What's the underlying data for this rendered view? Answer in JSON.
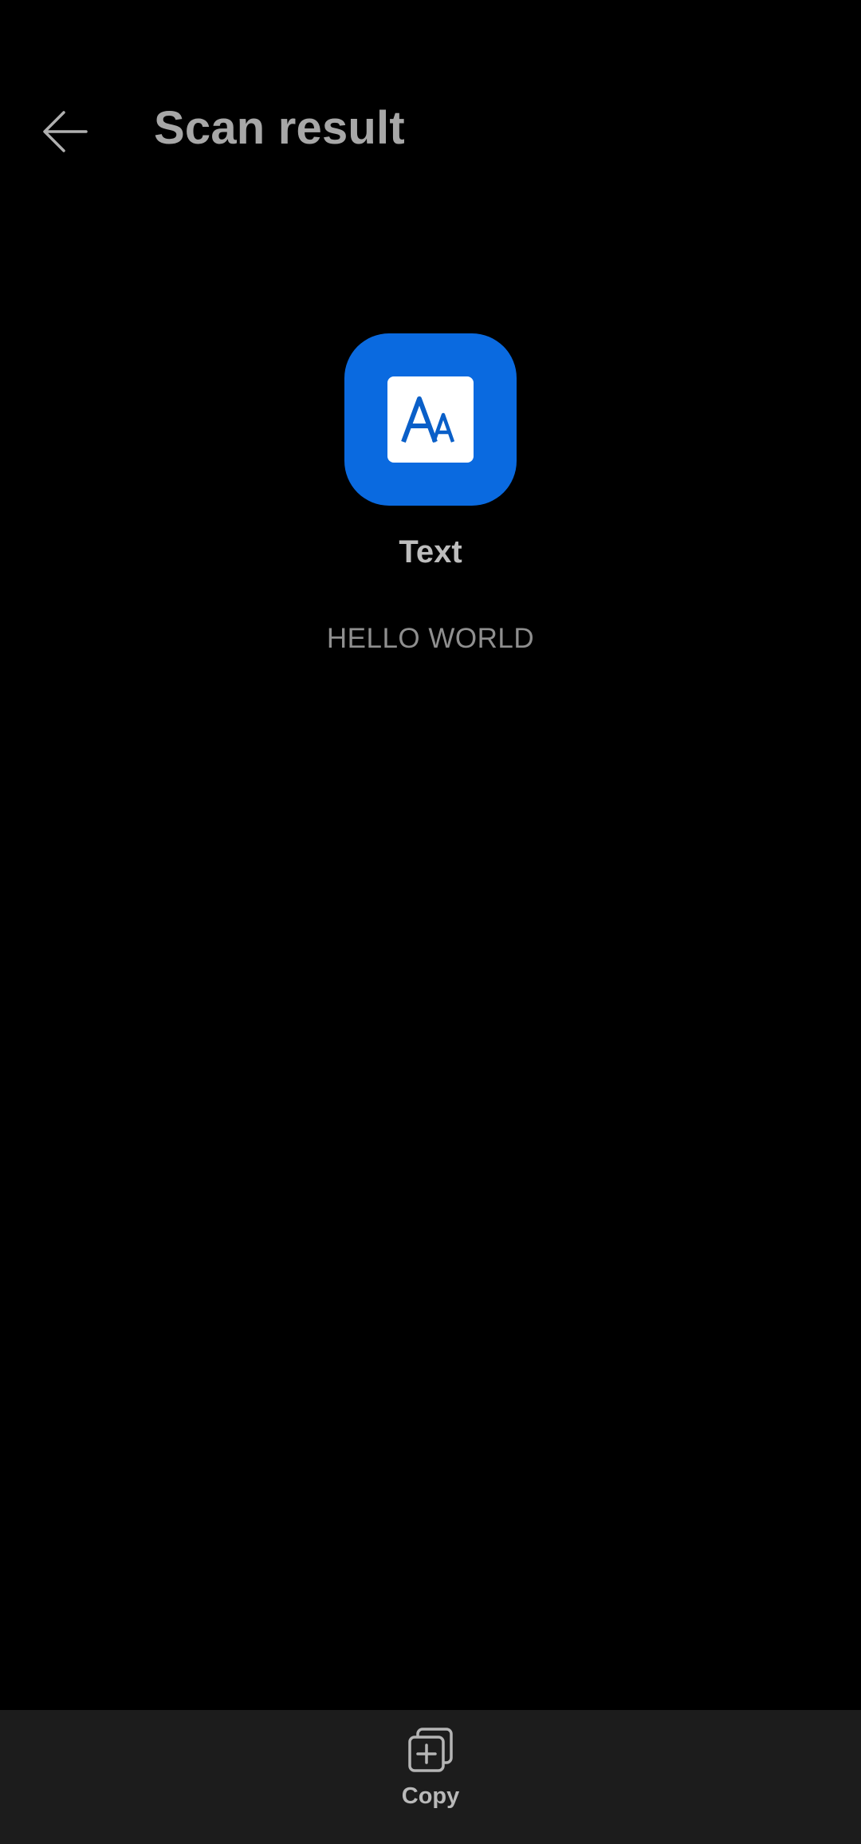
{
  "header": {
    "title": "Scan result",
    "back_icon": "arrow-left-icon"
  },
  "result": {
    "type_icon": "text-format-icon",
    "type_label": "Text",
    "content": "HELLO WORLD"
  },
  "actions": {
    "copy_label": "Copy",
    "copy_icon": "copy-icon"
  },
  "colors": {
    "background": "#000000",
    "accent": "#0a6ae0",
    "bottom_bar": "#1c1c1c",
    "title_text": "#a7a7a7"
  }
}
